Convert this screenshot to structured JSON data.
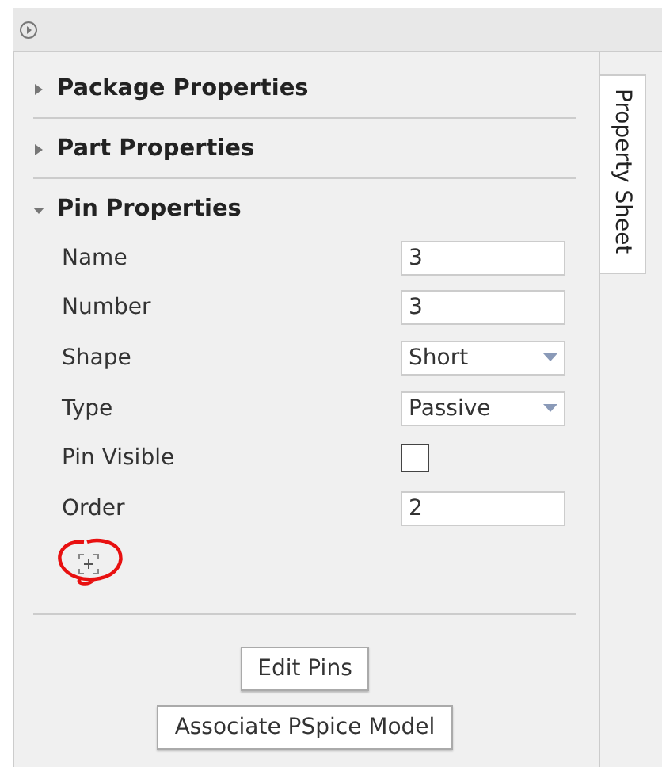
{
  "side_tab": {
    "label": "Property Sheet",
    "selected": true
  },
  "sections": [
    {
      "title": "Package Properties",
      "expanded": false
    },
    {
      "title": "Part Properties",
      "expanded": false
    },
    {
      "title": "Pin Properties",
      "expanded": true
    }
  ],
  "properties": [
    {
      "label": "Name",
      "kind": "text",
      "value": "3"
    },
    {
      "label": "Number",
      "kind": "text",
      "value": "3"
    },
    {
      "label": "Shape",
      "kind": "dropdown",
      "value": "Short"
    },
    {
      "label": "Type",
      "kind": "dropdown",
      "value": "Passive"
    },
    {
      "label": "Pin Visible",
      "kind": "checkbox",
      "checked": false
    },
    {
      "label": "Order",
      "kind": "text",
      "value": "2"
    }
  ],
  "buttons": [
    "Edit Pins",
    "Associate PSpice Model"
  ]
}
